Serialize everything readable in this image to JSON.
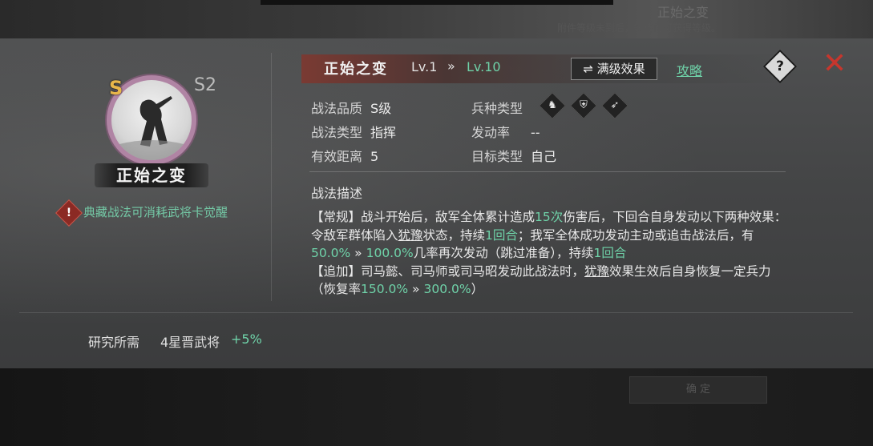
{
  "background": {
    "top_title": "正始之变",
    "top_sub": "附件等级未到后，等待门可获得等级。",
    "bottom_button": "确 定"
  },
  "hero": {
    "grade": "S",
    "level_tag": "S2",
    "name": "正始之变",
    "awaken_icon": "!",
    "awaken_text": "典藏战法可消耗武将卡觉醒"
  },
  "header": {
    "title": "正始之变",
    "lv_from": "Lv.1",
    "lv_arrow": "»",
    "lv_to": "Lv.10",
    "max_effect_button": "⇌ 满级效果",
    "guide_link": "攻略",
    "help_icon": "?",
    "close_icon": "✕"
  },
  "attributes": {
    "quality_label": "战法品质",
    "quality_value": "S级",
    "type_label": "战法类型",
    "type_value": "指挥",
    "range_label": "有效距离",
    "range_value": "5",
    "troop_label": "兵种类型",
    "troop_icons": [
      "cavalry-icon",
      "shield-icon",
      "bow-icon"
    ],
    "rate_label": "发动率",
    "rate_value": "--",
    "target_label": "目标类型",
    "target_value": "自己"
  },
  "description": {
    "label": "战法描述",
    "p1_a": "【常规】战斗开始后，敌军全体累计造成",
    "p1_b": "15次",
    "p1_c": "伤害后，下回合自身发动以下两种效果：令敌军群体陷入",
    "p1_d": "犹豫",
    "p1_e": "状态，持续",
    "p1_f": "1回合",
    "p1_g": "；我军全体成功发动主动或追击战法后，有",
    "p1_h": "50.0%",
    "p1_i": " » ",
    "p1_j": "100.0%",
    "p1_k": "几率再次发动（跳过准备），持续",
    "p1_l": "1回合",
    "p2_a": "【追加】司马懿、司马师或司马昭发动此战法时，",
    "p2_b": "犹豫",
    "p2_c": "效果生效后自身恢复一定兵力（恢复率",
    "p2_d": "150.0%",
    "p2_e": " » ",
    "p2_f": "300.0%",
    "p2_g": "）"
  },
  "research": {
    "label": "研究所需",
    "value": "4星晋武将",
    "bonus": "+5%"
  },
  "colors": {
    "accent_green": "#6fd3a9",
    "close_red": "#c7362d",
    "grade_gold": "#e7b64a",
    "portrait_ring": "#b084a4"
  }
}
